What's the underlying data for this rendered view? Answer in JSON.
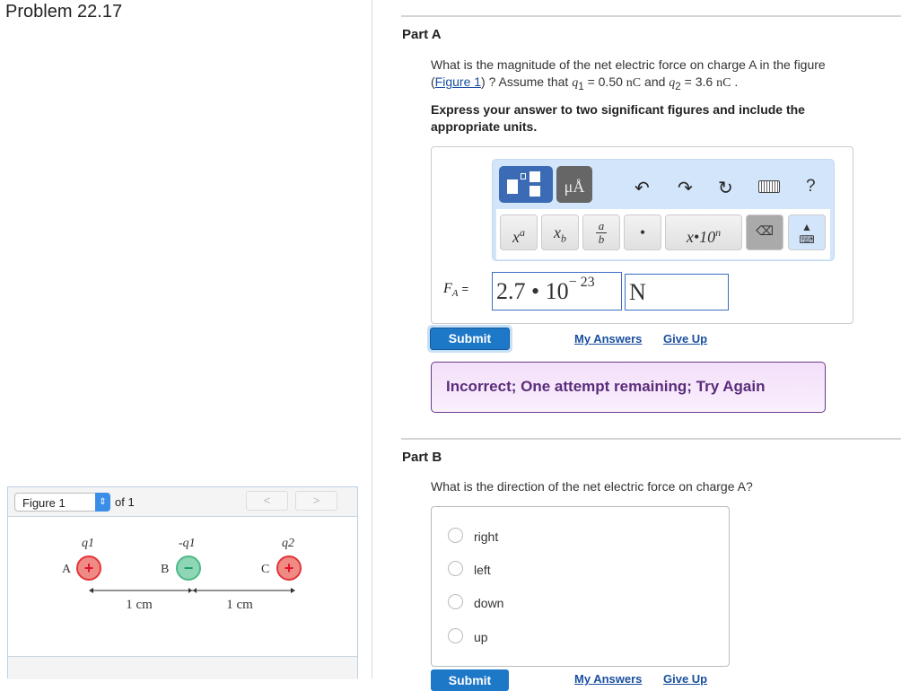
{
  "problem_title": "Problem 22.17",
  "figure": {
    "selector": "Figure 1",
    "of_label": "of 1",
    "prev": "<",
    "next": ">",
    "charges": [
      {
        "label": "A",
        "name": "q1",
        "sign": "+"
      },
      {
        "label": "B",
        "name": "-q1",
        "sign": "−"
      },
      {
        "label": "C",
        "name": "q2",
        "sign": "+"
      }
    ],
    "distances": [
      "1 cm",
      "1 cm"
    ]
  },
  "part_a": {
    "heading": "Part A",
    "question_1": "What is the magnitude of the net electric force on charge A in the figure",
    "figure_link": "Figure 1",
    "question_2": "? Assume that",
    "q1": "q",
    "q1_sub": "1",
    "q1_val": "= 0.50",
    "unit_nc": "nC",
    "and": "and",
    "q2": "q",
    "q2_sub": "2",
    "q2_val": "= 3.6",
    "period": ".",
    "instruction": "Express your answer to two significant figures and include the appropriate units.",
    "toolbar": {
      "templates": "templates-icon",
      "units": "μÅ",
      "help": "?",
      "buttons": [
        "x",
        "a",
        "x",
        "b",
        "a",
        "b",
        "•",
        "x•10",
        "n"
      ]
    },
    "answer_label": "F",
    "answer_sub": "A",
    "equals": "=",
    "value_mantissa": "2.7 • 10",
    "value_exponent": "− 23",
    "unit_value": "N",
    "submit": "Submit",
    "my_answers": "My Answers",
    "give_up": "Give Up",
    "feedback": "Incorrect; One attempt remaining; Try Again"
  },
  "part_b": {
    "heading": "Part B",
    "question": "What is the direction of the net electric force on charge A?",
    "options": [
      "right",
      "left",
      "down",
      "up"
    ],
    "submit": "Submit",
    "my_answers": "My Answers",
    "give_up": "Give Up"
  },
  "colors": {
    "submit": "#1e78c8",
    "link": "#1a4fa0",
    "feedback_text": "#5a2c7a",
    "positive": "#f08a84",
    "negative": "#8fd6b4"
  }
}
